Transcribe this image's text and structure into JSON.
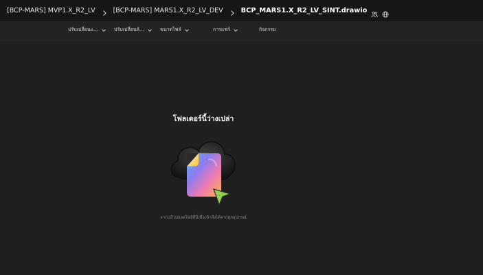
{
  "breadcrumb": {
    "items": [
      {
        "label": "[BCP-MARS] MVP1.X_R2_LV"
      },
      {
        "label": "[BCP-MARS] MARS1.X_R2_LV_DEV"
      },
      {
        "label": "BCP_MARS1.X_R2_LV_SINT.drawio"
      }
    ],
    "icons": [
      "people-icon",
      "globe-icon"
    ]
  },
  "toolbar": {
    "items": [
      {
        "label": "ปรับเปลี่ยนแ..."
      },
      {
        "label": "ปรับเปลี่ยนล้..."
      },
      {
        "label": "ขนาดไฟล์"
      },
      {
        "label": "การแชร์"
      },
      {
        "label": "กิจกรรม"
      }
    ]
  },
  "empty_state": {
    "title": "โฟลเดอร์นี้ว่างเปล่า",
    "hint": "ลากแล้วปล่อยไฟล์ที่นี่เพื่อเข้าถึงได้จากทุกอุปกรณ์"
  },
  "colors": {
    "background": "#1f1f1f",
    "topbar": "#161616",
    "cursor_green": "#8fd14f"
  }
}
